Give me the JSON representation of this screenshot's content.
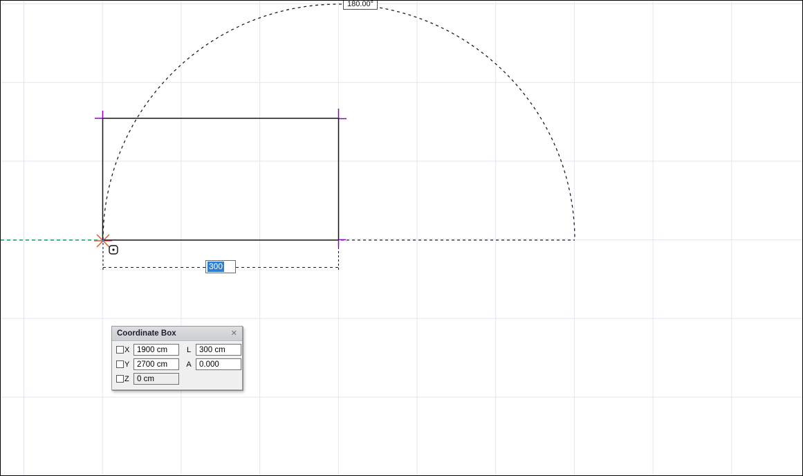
{
  "canvas": {
    "angle_label": "180.00°",
    "tracker_value": "300"
  },
  "coordinate_box": {
    "title": "Coordinate Box",
    "close_icon": "✕",
    "rows": [
      {
        "axis": "X",
        "value": "1900 cm",
        "label2": "L",
        "value2": "300 cm"
      },
      {
        "axis": "Y",
        "value": "2700 cm",
        "label2": "A",
        "value2": "0.000"
      },
      {
        "axis": "Z",
        "value": "0 cm"
      }
    ]
  },
  "colors": {
    "grid": "#e4e4ee",
    "drawing_ink": "#1c1c28",
    "guide_green": "#00a651",
    "origin_orange": "#e0562e",
    "hotspot_purple": "#8a00cc",
    "selection_blue": "#2e7ed2"
  }
}
